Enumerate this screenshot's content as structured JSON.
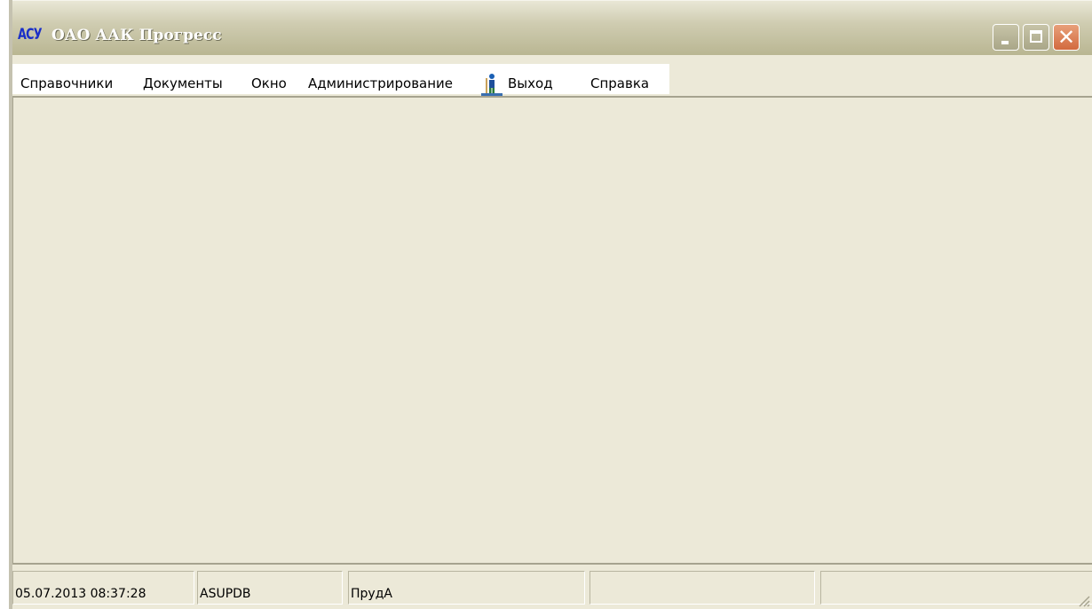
{
  "window": {
    "logo_text": "АСУ",
    "title": "ОАО ААК Прогресс",
    "controls": {
      "minimize": "minimize",
      "maximize": "maximize",
      "close": "✕"
    }
  },
  "menu": {
    "items": [
      {
        "label": "Справочники"
      },
      {
        "label": "Документы"
      },
      {
        "label": "Окно"
      },
      {
        "label": "Администрирование"
      },
      {
        "label": "Выход",
        "icon": "exit-person-icon"
      },
      {
        "label": "Справка"
      }
    ]
  },
  "status": {
    "panels": [
      {
        "text": "05.07.2013 08:37:28"
      },
      {
        "text": "ASUPDB"
      },
      {
        "text": "ПрудА"
      },
      {
        "text": ""
      },
      {
        "text": ""
      }
    ]
  },
  "colors": {
    "window_bg": "#ece9d8",
    "logo": "#1a2fc8",
    "close_button": "#d26a3e"
  }
}
